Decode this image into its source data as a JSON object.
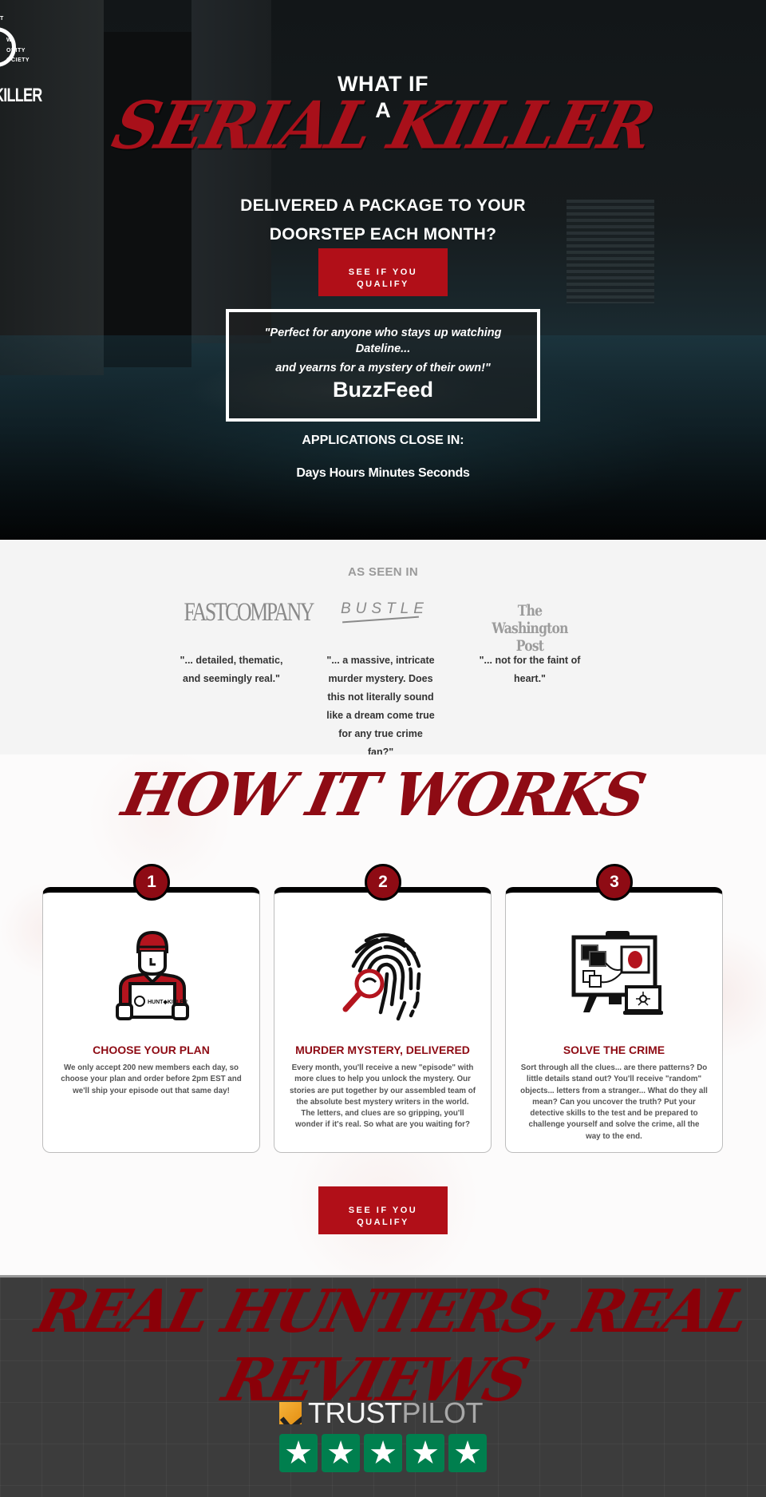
{
  "hero": {
    "logo": {
      "small_lines": [
        "T",
        "W",
        "ONITY",
        "OCIETY"
      ],
      "wordmark": "KILLER"
    },
    "headline_top": "WHAT IF",
    "headline_a": "A",
    "headline_main": "SERIAL KILLER",
    "subheadline_line1": "DELIVERED A PACKAGE TO YOUR",
    "subheadline_line2": "DOORSTEP EACH MONTH?",
    "cta": {
      "line1": "SEE IF YOU",
      "line2": "QUALIFY"
    },
    "quote": {
      "line1": "\"Perfect for anyone who stays up watching Dateline...",
      "line2": "and yearns for a mystery of their own!\"",
      "source": "BuzzFeed"
    },
    "applications_label": "APPLICATIONS CLOSE IN:",
    "countdown": "Days Hours Minutes Seconds"
  },
  "as_seen_in": {
    "title": "AS SEEN IN",
    "outlets": [
      {
        "name": "FAST COMPANY",
        "logo_text": "FASTCOMPANY",
        "quote": "\"... detailed, thematic, and seemingly real.\""
      },
      {
        "name": "BUSTLE",
        "logo_text": "BUSTLE",
        "quote": "\"... a massive, intricate murder mystery. Does this not literally sound like a dream come true for any true crime fan?\""
      },
      {
        "name": "The Washington Post",
        "logo_text": "The Washington Post",
        "quote": "\"... not for the faint of heart.\""
      }
    ]
  },
  "how_it_works": {
    "title": "HOW IT WORKS",
    "steps": [
      {
        "number": "1",
        "icon": "delivery-person-icon",
        "box_label": "HUNT◆KILLER",
        "title": "CHOOSE YOUR PLAN",
        "description": "We only accept 200 new members each day, so choose your plan and order before 2pm EST and we'll ship your episode out that same day!"
      },
      {
        "number": "2",
        "icon": "fingerprint-magnifier-icon",
        "title": "MURDER MYSTERY, DELIVERED",
        "description": "Every month, you'll receive a new \"episode\" with more clues to help you unlock the mystery. Our stories are put together by our assembled team of the absolute best mystery writers in the world. The letters, and clues are so gripping, you'll wonder if it's real. So what are you waiting for?"
      },
      {
        "number": "3",
        "icon": "evidence-board-icon",
        "title": "SOLVE THE CRIME",
        "description": "Sort through all the clues... are there patterns? Do little details stand out? You'll receive \"random\" objects... letters from a stranger... What do they all mean? Can you uncover the truth? Put your detective skills to the test and be prepared to challenge yourself and solve the crime, all the way to the end."
      }
    ],
    "cta": {
      "line1": "SEE IF YOU",
      "line2": "QUALIFY"
    }
  },
  "reviews": {
    "title": "REAL HUNTERS, REAL REVIEWS",
    "trustpilot": {
      "brand_part1": "TRUST",
      "brand_part2": "PILOT",
      "rating": 5,
      "max_rating": 5,
      "star_glyph": "★"
    }
  },
  "colors": {
    "brand_red": "#b10f18",
    "heading_red": "#8e0b14",
    "trustpilot_green": "#007f4e",
    "reviews_bg": "#3c3c3c",
    "press_bg": "#f4f4f4"
  }
}
